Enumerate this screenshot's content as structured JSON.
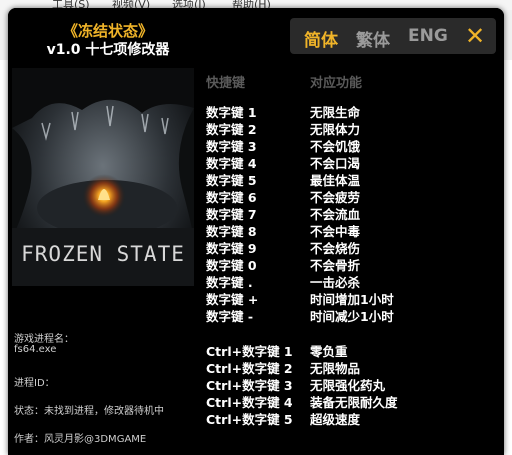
{
  "background_app": {
    "menu": [
      "工具(S)",
      "视频(V)",
      "选项(I)",
      "帮助(H)"
    ]
  },
  "title": {
    "line1": "《冻结状态》",
    "line2": "v1.0 十七项修改器"
  },
  "languages": {
    "simplified": "简体",
    "traditional": "繁体",
    "english": "ENG",
    "close": "✕"
  },
  "game_cover": {
    "logo_text": "FROZEN STATE"
  },
  "info": {
    "process_label": "游戏进程名：",
    "process_name": "fs64.exe",
    "process_id_label": "进程ID：",
    "status": "状态：未找到进程，修改器待机中",
    "author": "作者：风灵月影@3DMGAME"
  },
  "table": {
    "header_key": "快捷键",
    "header_fn": "对应功能",
    "rows": [
      {
        "key": "数字键 1",
        "fn": "无限生命"
      },
      {
        "key": "数字键 2",
        "fn": "无限体力"
      },
      {
        "key": "数字键 3",
        "fn": "不会饥饿"
      },
      {
        "key": "数字键 4",
        "fn": "不会口渴"
      },
      {
        "key": "数字键 5",
        "fn": "最佳体温"
      },
      {
        "key": "数字键 6",
        "fn": "不会疲劳"
      },
      {
        "key": "数字键 7",
        "fn": "不会流血"
      },
      {
        "key": "数字键 8",
        "fn": "不会中毒"
      },
      {
        "key": "数字键 9",
        "fn": "不会烧伤"
      },
      {
        "key": "数字键 0",
        "fn": "不会骨折"
      },
      {
        "key": "数字键 .",
        "fn": "一击必杀"
      },
      {
        "key": "数字键 +",
        "fn": "时间增加1小时"
      },
      {
        "key": "数字键 -",
        "fn": "时间减少1小时"
      }
    ],
    "ctrl_rows": [
      {
        "key": "Ctrl+数字键 1",
        "fn": "零负重"
      },
      {
        "key": "Ctrl+数字键 2",
        "fn": "无限物品"
      },
      {
        "key": "Ctrl+数字键 3",
        "fn": "无限强化药丸"
      },
      {
        "key": "Ctrl+数字键 4",
        "fn": "装备无限耐久度"
      },
      {
        "key": "Ctrl+数字键 5",
        "fn": "超级速度"
      }
    ]
  },
  "colors": {
    "accent": "#f0b429",
    "background": "#000000",
    "inactive_lang": "#9a9a9a"
  }
}
